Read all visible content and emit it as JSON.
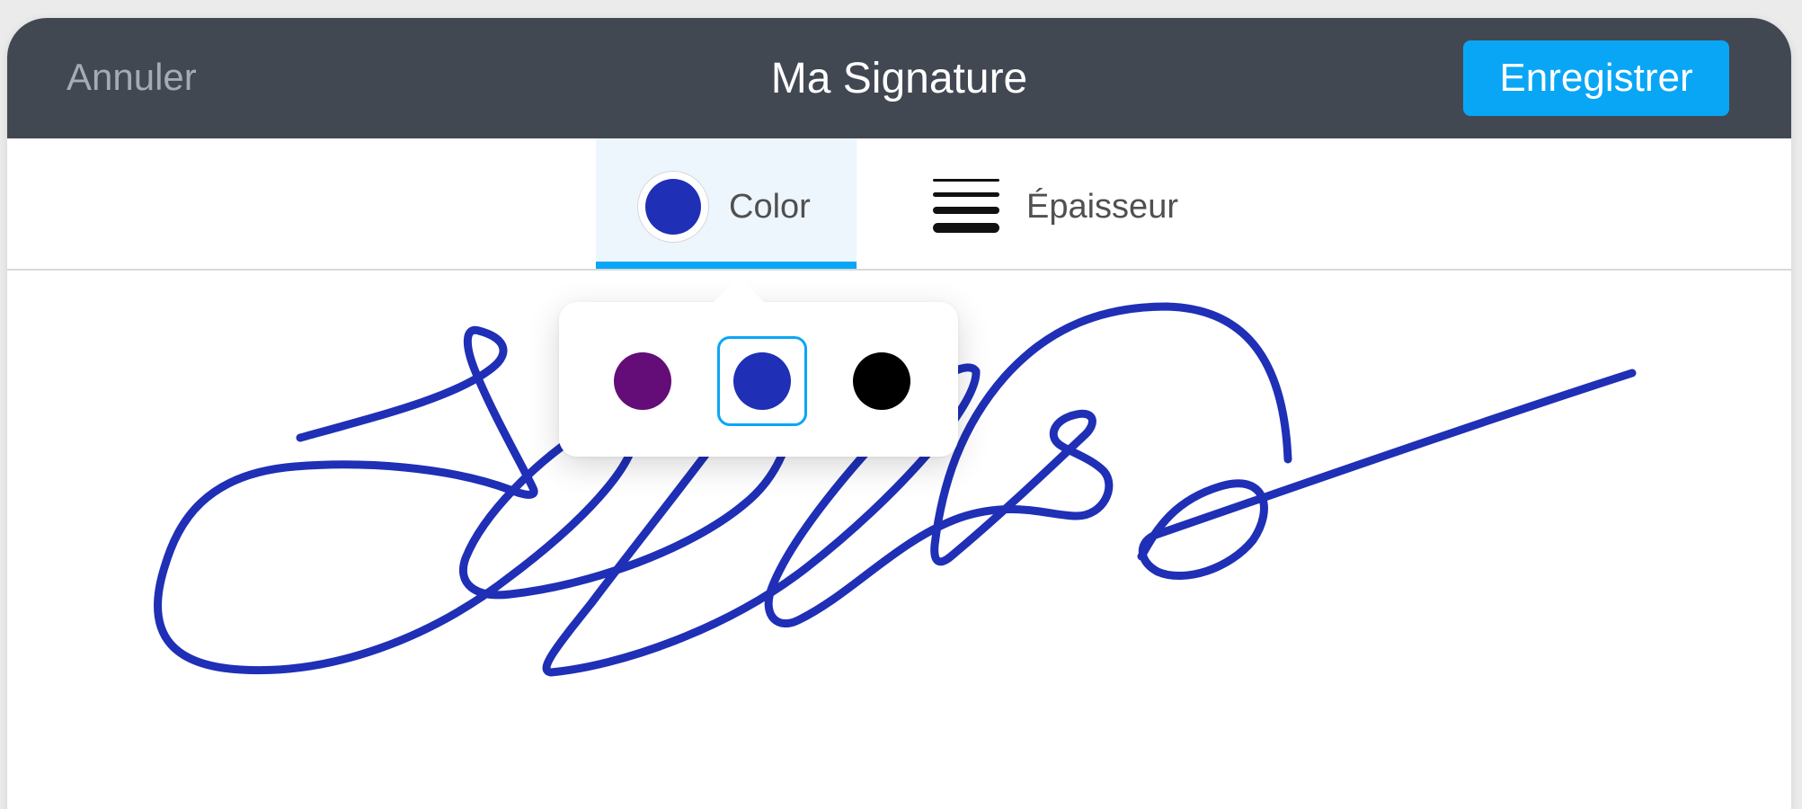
{
  "header": {
    "cancel_label": "Annuler",
    "title": "Ma Signature",
    "save_label": "Enregistrer"
  },
  "toolbar": {
    "color_tab": {
      "label": "Color",
      "current_color": "#1f2fb6",
      "selected": true
    },
    "thickness_tab": {
      "label": "Épaisseur",
      "icon": "line-weight-icon"
    }
  },
  "color_picker": {
    "swatches": [
      {
        "name": "purple",
        "color": "#640c78",
        "selected": false
      },
      {
        "name": "blue",
        "color": "#1f2fb6",
        "selected": true
      },
      {
        "name": "black",
        "color": "#000000",
        "selected": false
      }
    ]
  },
  "signature": {
    "stroke_color": "#1f2fb6"
  },
  "colors": {
    "titlebar": "#424852",
    "accent": "#0aa6f6",
    "cancel_text": "#a6abb3"
  }
}
